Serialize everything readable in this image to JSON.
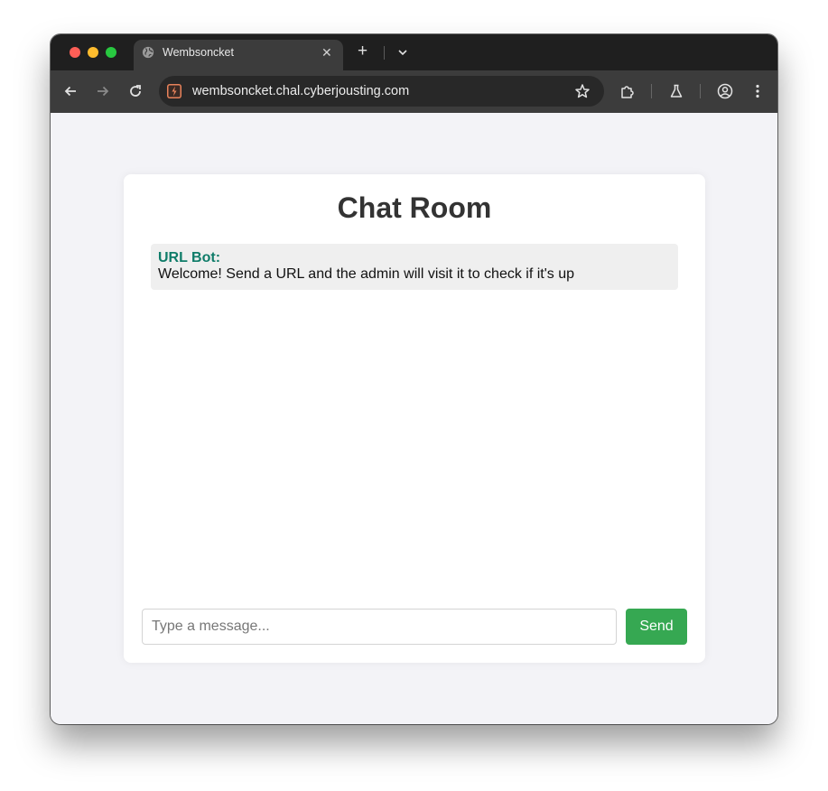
{
  "browser": {
    "tab": {
      "title": "Wembsoncket",
      "favicon": "globe-icon",
      "close_glyph": "✕"
    },
    "new_tab_glyph": "+",
    "address_bar": {
      "url": "wembsoncket.chal.cyberjousting.com",
      "site_icon": "lightning-icon"
    },
    "accent_colors": {
      "close": "#fe5f57",
      "minimize": "#febc2e",
      "maximize": "#28c840"
    }
  },
  "page": {
    "heading": "Chat Room",
    "messages": [
      {
        "sender": "URL Bot:",
        "text": "Welcome! Send a URL and the admin will visit it to check if it's up"
      }
    ],
    "input": {
      "placeholder": "Type a message...",
      "value": ""
    },
    "send_label": "Send",
    "colors": {
      "sender": "#0f7c69",
      "send_button": "#36a852",
      "background": "#f3f3f7"
    }
  }
}
